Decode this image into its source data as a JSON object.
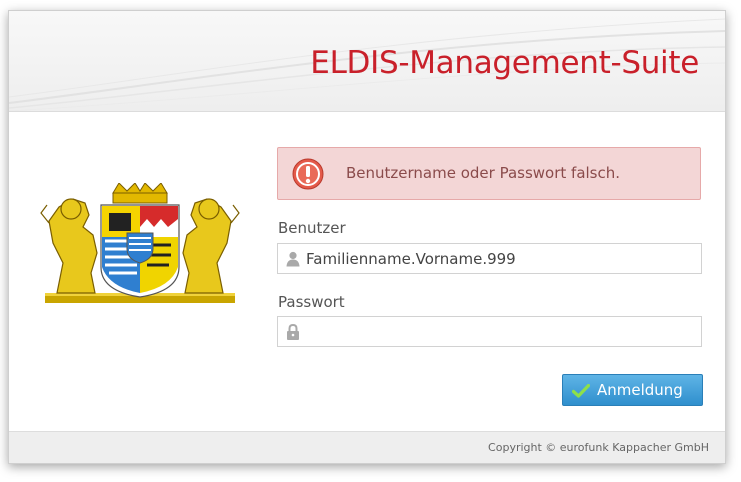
{
  "app": {
    "title": "ELDIS-Management-Suite"
  },
  "alert": {
    "message": "Benutzername oder Passwort falsch.",
    "icon": "exclamation-circle-icon",
    "color": "#e04545"
  },
  "form": {
    "user_label": "Benutzer",
    "user_value": "Familienname.Vorname.999",
    "user_icon": "person-icon",
    "password_label": "Passwort",
    "password_value": "",
    "password_icon": "lock-icon"
  },
  "login": {
    "label": "Anmeldung",
    "icon": "checkmark-icon",
    "accent": "#3a9ad9"
  },
  "footer": {
    "copyright": "Copyright © eurofunk Kappacher GmbH"
  },
  "crest": {
    "icon": "bavarian-coat-of-arms-icon"
  }
}
